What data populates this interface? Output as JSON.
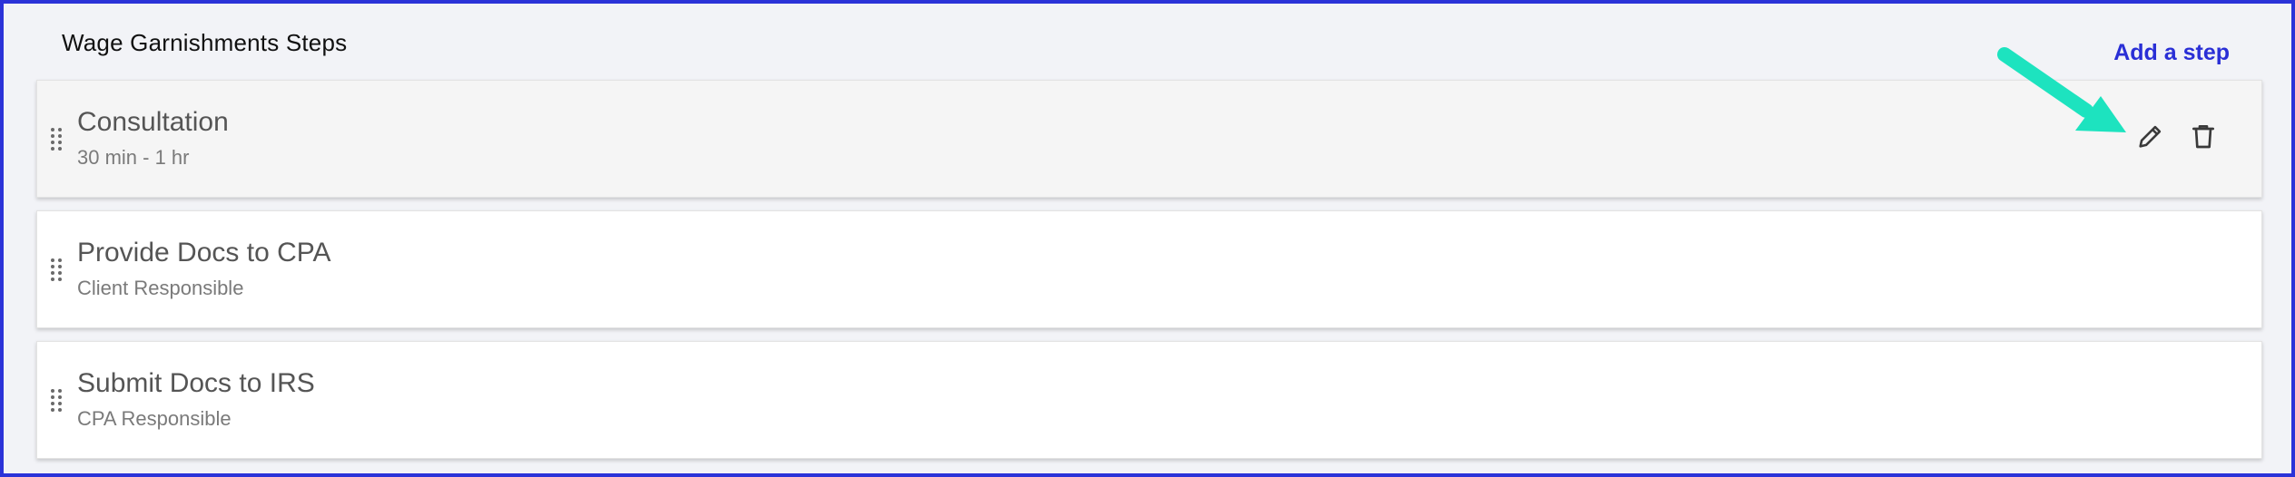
{
  "section": {
    "title": "Wage Garnishments Steps",
    "add_step_label": "Add a step"
  },
  "steps": [
    {
      "title": "Consultation",
      "subtitle": "30 min - 1 hr"
    },
    {
      "title": "Provide Docs to CPA",
      "subtitle": "Client Responsible"
    },
    {
      "title": "Submit Docs to IRS",
      "subtitle": "CPA Responsible"
    }
  ],
  "icons": {
    "edit": "pencil-icon",
    "delete": "trash-icon",
    "drag": "drag-handle-icon",
    "annotation": "arrow-annotation"
  },
  "colors": {
    "frame_border": "#2b33d8",
    "accent_link": "#2a2fd6",
    "annotation_arrow": "#1de3bf",
    "background": "#f2f3f7"
  }
}
